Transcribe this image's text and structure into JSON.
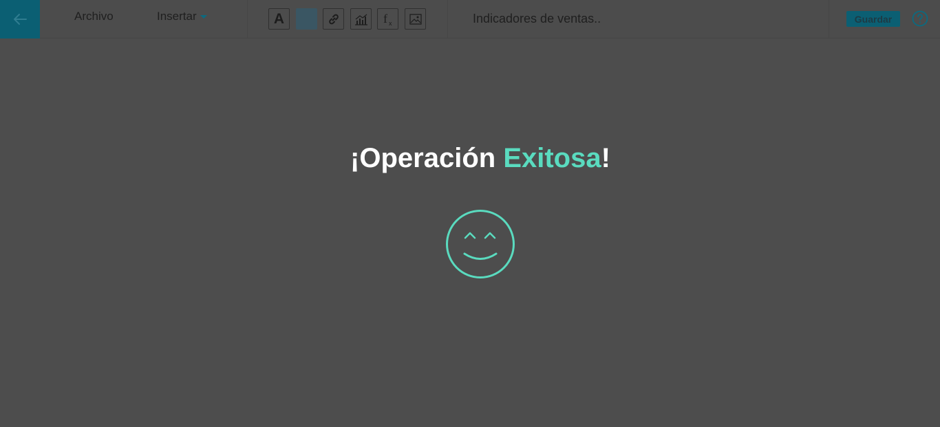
{
  "toolbar": {
    "menu": {
      "archivo": "Archivo",
      "insertar": "Insertar"
    },
    "tools": {
      "text_tool_glyph": "A"
    },
    "doc_title": "Indicadores de ventas..",
    "save_label": "Guardar"
  },
  "message": {
    "prefix": "¡Operación ",
    "highlight": "Exitosa",
    "suffix": "!"
  },
  "colors": {
    "background": "#4d4d4d",
    "accent": "#5adbbf",
    "brand": "#0b5f73"
  },
  "icons": [
    "back-arrow-icon",
    "caret-down-icon",
    "text-format-icon",
    "color-swatch-icon",
    "link-icon",
    "chart-icon",
    "function-icon",
    "image-icon",
    "help-icon",
    "smiley-icon"
  ]
}
